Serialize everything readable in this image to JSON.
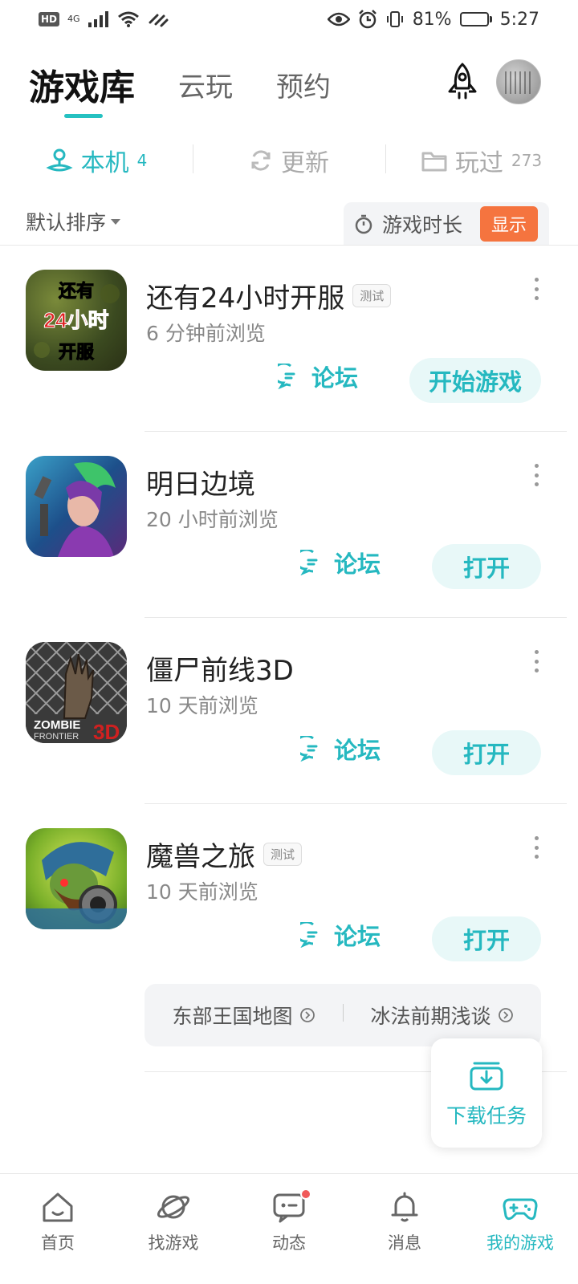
{
  "status_bar": {
    "hd": "HD",
    "network": "4G",
    "battery_percent": "81%",
    "battery_level": 0.81,
    "time": "5:27"
  },
  "top_tabs": {
    "library": "游戏库",
    "cloud": "云玩",
    "reserve": "预约"
  },
  "sub_tabs": {
    "local": {
      "label": "本机",
      "count": "4"
    },
    "update": {
      "label": "更新"
    },
    "played": {
      "label": "玩过",
      "count": "273"
    }
  },
  "sort": {
    "label": "默认排序",
    "playtime_label": "游戏时长",
    "playtime_toggle": "显示"
  },
  "games": [
    {
      "title": "还有24小时开服",
      "badge": "测试",
      "viewed": "6 分钟前浏览",
      "forum": "论坛",
      "action": "开始游戏",
      "icon_text": [
        "还有",
        "24小时",
        "开服"
      ]
    },
    {
      "title": "明日边境",
      "badge": "",
      "viewed": "20 小时前浏览",
      "forum": "论坛",
      "action": "打开"
    },
    {
      "title": "僵尸前线3D",
      "badge": "",
      "viewed": "10 天前浏览",
      "forum": "论坛",
      "action": "打开",
      "icon_text": [
        "ZOMBIE",
        "FRONTIER",
        "3D"
      ]
    },
    {
      "title": "魔兽之旅",
      "badge": "测试",
      "viewed": "10 天前浏览",
      "forum": "论坛",
      "action": "打开"
    }
  ],
  "strategy_links": [
    "东部王国地图",
    "冰法前期浅谈"
  ],
  "download_task": "下载任务",
  "bottom_nav": {
    "home": "首页",
    "find": "找游戏",
    "feed": "动态",
    "messages": "消息",
    "my_games": "我的游戏"
  },
  "colors": {
    "accent": "#25b8c0",
    "badge_orange": "#f5743f",
    "notify_red": "#f05a5a"
  }
}
